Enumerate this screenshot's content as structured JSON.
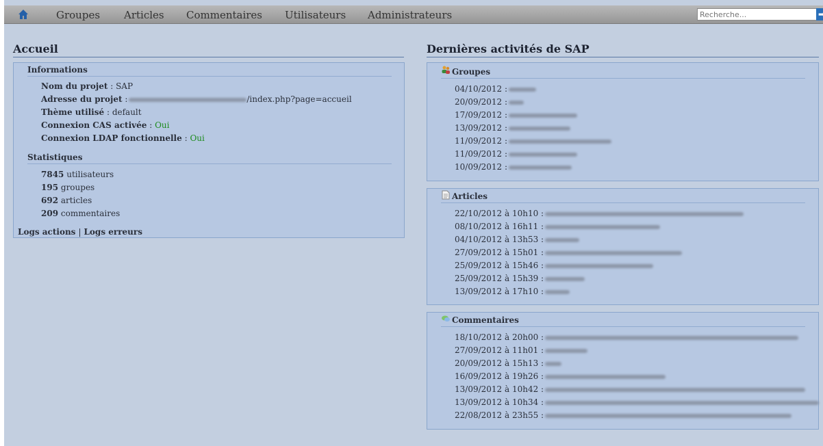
{
  "nav": {
    "items": [
      "Groupes",
      "Articles",
      "Commentaires",
      "Utilisateurs",
      "Administrateurs"
    ],
    "search_placeholder": "Recherche..."
  },
  "left": {
    "title": "Accueil",
    "informations": {
      "heading": "Informations",
      "project_name_label": "Nom du projet",
      "project_name_value": "SAP",
      "address_label": "Adresse du projet",
      "address_value_suffix": "/index.php?page=accueil",
      "theme_label": "Thème utilisé",
      "theme_value": "default",
      "cas_label": "Connexion CAS activée",
      "cas_value": "Oui",
      "ldap_label": "Connexion LDAP fonctionnelle",
      "ldap_value": "Oui"
    },
    "statistiques": {
      "heading": "Statistiques",
      "users_count": "7845",
      "users_label": "utilisateurs",
      "groups_count": "195",
      "groups_label": "groupes",
      "articles_count": "692",
      "articles_label": "articles",
      "comments_count": "209",
      "comments_label": "commentaires"
    },
    "logs_actions": "Logs actions",
    "logs_separator": "|",
    "logs_errors": "Logs erreurs"
  },
  "right": {
    "title": "Dernières activités de SAP",
    "groupes": {
      "heading": "Groupes",
      "entries": [
        "04/10/2012 :",
        "20/09/2012 :",
        "17/09/2012 :",
        "13/09/2012 :",
        "11/09/2012 :",
        "11/09/2012 :",
        "10/09/2012 :"
      ]
    },
    "articles": {
      "heading": "Articles",
      "entries": [
        "22/10/2012 à 10h10 :",
        "08/10/2012 à 16h11 :",
        "04/10/2012 à 13h53 :",
        "27/09/2012 à 15h01 :",
        "25/09/2012 à 15h46 :",
        "25/09/2012 à 15h39 :",
        "13/09/2012 à 17h10 :"
      ]
    },
    "commentaires": {
      "heading": "Commentaires",
      "entries": [
        "18/10/2012 à 20h00 :",
        "27/09/2012 à 11h01 :",
        "20/09/2012 à 15h13 :",
        "16/09/2012 à 19h26 :",
        "13/09/2012 à 10h42 :",
        "13/09/2012 à 10h34 :",
        "22/08/2012 à 23h55 :"
      ]
    }
  }
}
